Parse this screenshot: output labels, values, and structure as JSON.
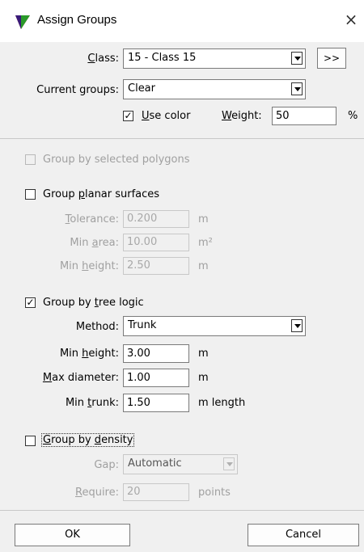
{
  "window": {
    "title": "Assign Groups",
    "icon": "red-green-triangle-app-icon",
    "close_glyph": "×"
  },
  "class": {
    "label": "Class:",
    "value": "15 - Class 15",
    "more_button": ">>"
  },
  "current_groups": {
    "label": "Current groups:",
    "value": "Clear"
  },
  "use_color": {
    "label": "Use color",
    "checked": true
  },
  "weight": {
    "label": "Weight:",
    "value": "50",
    "unit": "%"
  },
  "group_by_selected_polygons": {
    "label": "Group by selected polygons",
    "checked": false,
    "enabled": false
  },
  "group_planar_surfaces": {
    "label": "Group planar surfaces",
    "checked": false,
    "tolerance": {
      "label": "Tolerance:",
      "value": "0.200",
      "unit": "m"
    },
    "min_area": {
      "label": "Min area:",
      "value": "10.00",
      "unit": "m²"
    },
    "min_height": {
      "label": "Min height:",
      "value": "2.50",
      "unit": "m"
    }
  },
  "group_by_tree_logic": {
    "label": "Group by tree logic",
    "checked": true,
    "method": {
      "label": "Method:",
      "value": "Trunk"
    },
    "min_height": {
      "label": "Min height:",
      "value": "3.00",
      "unit": "m"
    },
    "max_diameter": {
      "label": "Max diameter:",
      "value": "1.00",
      "unit": "m"
    },
    "min_trunk": {
      "label": "Min trunk:",
      "value": "1.50",
      "unit": "m length"
    }
  },
  "group_by_density": {
    "label": "Group by density",
    "checked": false,
    "gap": {
      "label": "Gap:",
      "value": "Automatic"
    },
    "require": {
      "label": "Require:",
      "value": "20",
      "unit": "points"
    }
  },
  "buttons": {
    "ok": "OK",
    "cancel": "Cancel"
  }
}
